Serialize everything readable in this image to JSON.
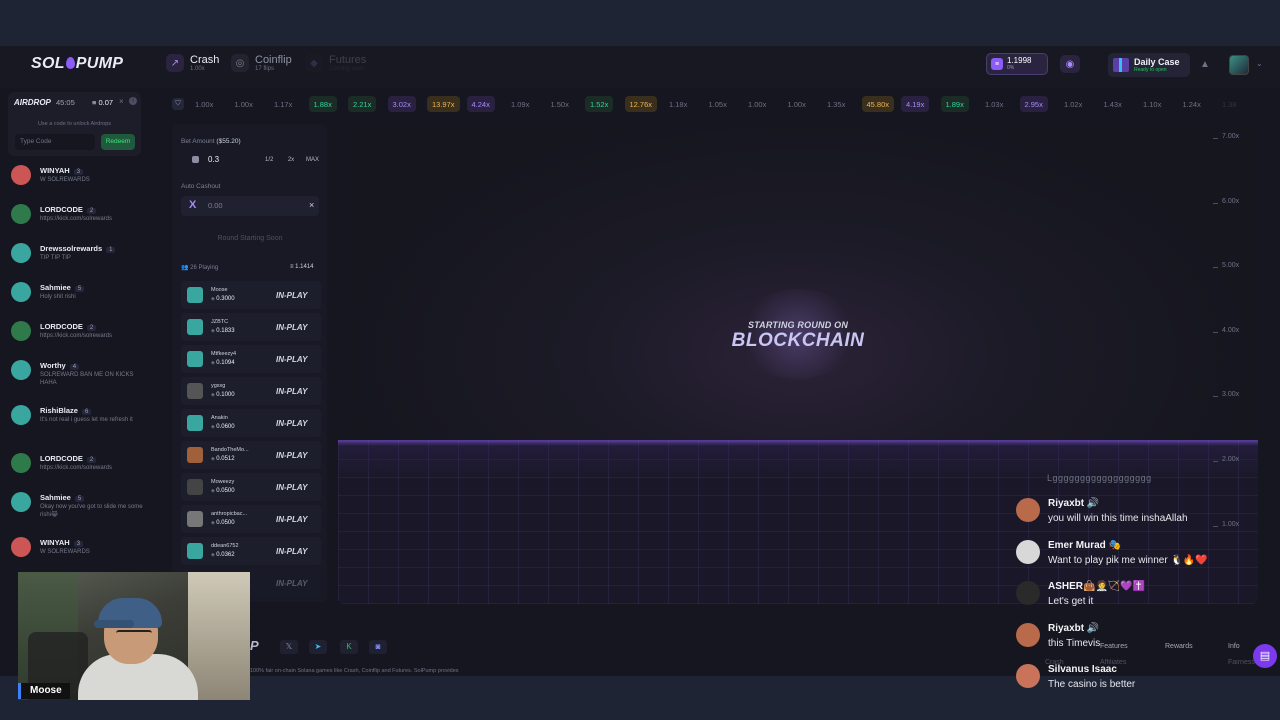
{
  "header": {
    "logo_text": "SOLPUMP",
    "nav": [
      {
        "label": "Crash",
        "sub": "1.00x"
      },
      {
        "label": "Coinflip",
        "sub": "17 flips"
      },
      {
        "label": "Futures",
        "sub": "Coming soon"
      }
    ],
    "balance": {
      "amount": "1.1998",
      "sub": "0%"
    },
    "daily_case": {
      "title": "Daily Case",
      "sub": "Ready to open"
    }
  },
  "multipliers": [
    "1.00x",
    "1.00x",
    "1.17x",
    "1.88x",
    "2.21x",
    "3.02x",
    "13.97x",
    "4.24x",
    "1.09x",
    "1.50x",
    "1.52x",
    "12.76x",
    "1.18x",
    "1.05x",
    "1.00x",
    "1.00x",
    "1.35x",
    "45.80x",
    "4.19x",
    "1.89x",
    "1.03x",
    "2.95x",
    "1.02x",
    "1.43x",
    "1.10x",
    "1.24x",
    "1.38"
  ],
  "multiplier_colors": [
    "grey",
    "grey",
    "grey",
    "green",
    "green",
    "purple",
    "gold",
    "purple",
    "grey",
    "grey",
    "green",
    "gold",
    "grey",
    "grey",
    "grey",
    "grey",
    "grey",
    "gold",
    "purple",
    "green",
    "grey",
    "purple",
    "grey",
    "grey",
    "grey",
    "grey",
    "grey"
  ],
  "airdrop": {
    "label": "AIRDROP",
    "timer": "45:05",
    "amount": "0.07",
    "hint": "Use a code to unlock Airdrops",
    "code_placeholder": "Type Code",
    "redeem_label": "Redeem"
  },
  "chat": [
    {
      "name": "WINYAH",
      "level": "3",
      "message": "W SOLREWARDS"
    },
    {
      "name": "LORDCODE",
      "level": "2",
      "message": "https://kick.com/solrewards"
    },
    {
      "name": "Drewssolrewards",
      "level": "1",
      "message": "TIP TIP TIP"
    },
    {
      "name": "Sahmiee",
      "level": "5",
      "message": "Holy shit rishi"
    },
    {
      "name": "LORDCODE",
      "level": "2",
      "message": "https://kick.com/solrewards"
    },
    {
      "name": "Worthy",
      "level": "4",
      "message": "SOLREWARD BAN ME ON KICKS HAHA"
    },
    {
      "name": "RishiBlaze",
      "level": "6",
      "message": "It's not real i guess let me refresh it"
    },
    {
      "name": "LORDCODE",
      "level": "2",
      "message": "https://kick.com/solrewards"
    },
    {
      "name": "Sahmiee",
      "level": "5",
      "message": "Okay now you've got to slide me some rishi😹"
    },
    {
      "name": "WINYAH",
      "level": "3",
      "message": "W SOLREWARDS"
    }
  ],
  "bet": {
    "label": "Bet Amount",
    "usd": "($55.20)",
    "value": "0.3",
    "half": "1/2",
    "double": "2x",
    "max": "MAX",
    "auto_label": "Auto Cashout",
    "auto_value": "0.00",
    "round_button": "Round Starting Soon",
    "playing": "26 Playing",
    "playing_total": "1.1414"
  },
  "players": [
    {
      "name": "Moose",
      "bet": "0.3000",
      "status": "IN-PLAY"
    },
    {
      "name": "JZBTC",
      "bet": "0.1833",
      "status": "IN-PLAY"
    },
    {
      "name": "Mtfkeezy4",
      "bet": "0.1094",
      "status": "IN-PLAY"
    },
    {
      "name": "ygsxg",
      "bet": "0.1000",
      "status": "IN-PLAY"
    },
    {
      "name": "Anakin",
      "bet": "0.0600",
      "status": "IN-PLAY"
    },
    {
      "name": "BandoTheMo...",
      "bet": "0.0512",
      "status": "IN-PLAY"
    },
    {
      "name": "Moweezy",
      "bet": "0.0500",
      "status": "IN-PLAY"
    },
    {
      "name": "anthropicbac...",
      "bet": "0.0500",
      "status": "IN-PLAY"
    },
    {
      "name": "ddean6752",
      "bet": "0.0362",
      "status": "IN-PLAY"
    },
    {
      "name": "",
      "bet": "",
      "status": "IN-PLAY"
    }
  ],
  "game": {
    "starting_text": "STARTING ROUND ON",
    "chain_text": "BLOCKCHAIN",
    "y_ticks": [
      "7.00x",
      "6.00x",
      "5.00x",
      "4.00x",
      "3.00x",
      "2.00x",
      "1.00x"
    ]
  },
  "footer": {
    "logo": "P",
    "description": "100% fair on-chain Solana games like Crash, Coinflip and Futures. SolPump provides",
    "links": [
      "Features",
      "Rewards",
      "Info",
      "Crash",
      "Affiliates",
      "Fairness"
    ]
  },
  "stream_chat": {
    "top_text": "Lgggggggggggggggggg",
    "messages": [
      {
        "name": "Riyaxbt 🔊",
        "text": "you will win this time inshaAllah"
      },
      {
        "name": "Emer Murad 🎭",
        "text": "Want to play pik me winner 🐧🔥❤️"
      },
      {
        "name": "ASHER👜🧑‍⚕️🏹💜✝️",
        "text": "Let's get it"
      },
      {
        "name": "Riyaxbt 🔊",
        "text": "this Timevis"
      },
      {
        "name": "Silvanus Isaac",
        "text": "The casino is better"
      }
    ]
  },
  "webcam": {
    "name": "Moose"
  },
  "colors": {
    "accent": "#8b5cf6",
    "green": "#34d399",
    "gold": "#f0b44c"
  }
}
